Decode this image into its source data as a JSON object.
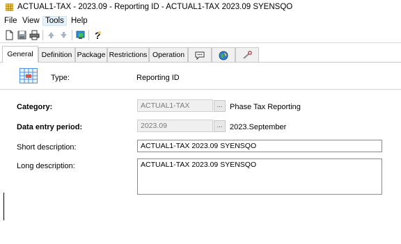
{
  "window": {
    "title": "ACTUAL1-TAX - 2023.09 - Reporting ID - ACTUAL1-TAX  2023.09 SYENSQO"
  },
  "menu": {
    "items": [
      {
        "label": "File"
      },
      {
        "label": "View"
      },
      {
        "label": "Tools"
      },
      {
        "label": "Help"
      }
    ]
  },
  "toolbar": {
    "icons": [
      "new-document-icon",
      "save-icon",
      "print-icon",
      "up-arrow-icon",
      "down-arrow-icon",
      "transfer-icon",
      "help-icon"
    ]
  },
  "tabs": [
    {
      "label": "General",
      "selected": true
    },
    {
      "label": "Definition"
    },
    {
      "label": "Package"
    },
    {
      "label": "Restrictions"
    },
    {
      "label": "Operation"
    },
    {
      "label": "",
      "icon": "comment-icon"
    },
    {
      "label": "",
      "icon": "globe-icon"
    },
    {
      "label": "",
      "icon": "key-icon"
    }
  ],
  "form": {
    "type_label": "Type:",
    "type_value": "Reporting ID",
    "category_label": "Category:",
    "category_value": "ACTUAL1-TAX",
    "category_desc": "Phase Tax Reporting",
    "period_label": "Data entry period:",
    "period_value": "2023.09",
    "period_desc": "2023.September",
    "short_desc_label": "Short description:",
    "short_desc_value": "ACTUAL1-TAX  2023.09 SYENSQO",
    "long_desc_label": "Long description:",
    "long_desc_value": "ACTUAL1-TAX  2023.09 SYENSQO",
    "browse_label": "..."
  },
  "colors": {
    "accent": "#0078d7",
    "icon_blue": "#4a90e2",
    "icon_red": "#d9534f"
  }
}
